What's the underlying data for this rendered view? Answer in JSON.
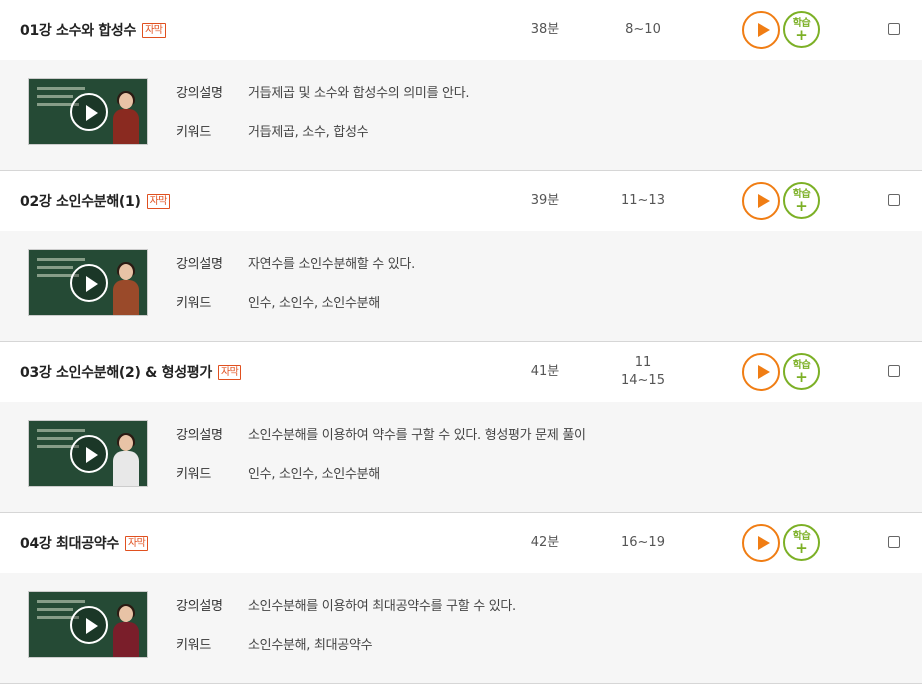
{
  "labels": {
    "description": "강의설명",
    "keyword": "키워드",
    "caption_badge": "자막",
    "study_add": "학습"
  },
  "lectures": [
    {
      "title": "01강 소수와 합성수",
      "duration": "38분",
      "pages": [
        "8~10"
      ],
      "description": "거듭제곱 및 소수와 합성수의 의미를 안다.",
      "keywords": "거듭제곱, 소수, 합성수"
    },
    {
      "title": "02강 소인수분해(1)",
      "duration": "39분",
      "pages": [
        "11~13"
      ],
      "description": "자연수를 소인수분해할 수 있다.",
      "keywords": "인수, 소인수, 소인수분해"
    },
    {
      "title": "03강 소인수분해(2) & 형성평가",
      "duration": "41분",
      "pages": [
        "11",
        "14~15"
      ],
      "description": "소인수분해를 이용하여 약수를 구할 수 있다. 형성평가 문제 풀이",
      "keywords": "인수, 소인수, 소인수분해"
    },
    {
      "title": "04강 최대공약수",
      "duration": "42분",
      "pages": [
        "16~19"
      ],
      "description": "소인수분해를 이용하여 최대공약수를 구할 수 있다.",
      "keywords": "소인수분해, 최대공약수"
    }
  ],
  "colors": {
    "play": "#f07d14",
    "study": "#7cb026",
    "badge": "#e0501f"
  }
}
